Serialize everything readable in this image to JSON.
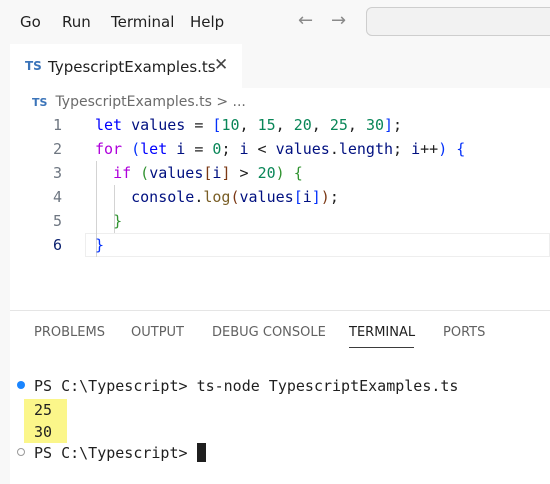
{
  "menu": {
    "items": [
      "Go",
      "Run",
      "Terminal",
      "Help"
    ],
    "back_arrow": "←",
    "forward_arrow": "→"
  },
  "tab": {
    "icon_text": "TS",
    "label": "TypescriptExamples.ts",
    "close": "✕"
  },
  "breadcrumb": {
    "icon_text": "TS",
    "file": "TypescriptExamples.ts",
    "separator": ">",
    "more": "..."
  },
  "editor": {
    "active_line": 6,
    "lines": [
      {
        "number": "1",
        "text": "let values = [10, 15, 20, 25, 30];"
      },
      {
        "number": "2",
        "text": "for (let i = 0; i < values.length; i++) {"
      },
      {
        "number": "3",
        "text": "  if (values[i] > 20) {"
      },
      {
        "number": "4",
        "text": "    console.log(values[i]);"
      },
      {
        "number": "5",
        "text": "  }"
      },
      {
        "number": "6",
        "text": "}"
      }
    ]
  },
  "panel": {
    "tabs": [
      "PROBLEMS",
      "OUTPUT",
      "DEBUG CONSOLE",
      "TERMINAL",
      "PORTS"
    ],
    "active_tab": "TERMINAL"
  },
  "terminal": {
    "prompt1": "PS C:\\Typescript> ",
    "command": "ts-node TypescriptExamples.ts",
    "output": [
      "25",
      "30"
    ],
    "prompt2": "PS C:\\Typescript> "
  },
  "colors": {
    "accent": "#1a85ff",
    "highlight": "#fbf68a",
    "ts_icon": "#3b74b9"
  }
}
